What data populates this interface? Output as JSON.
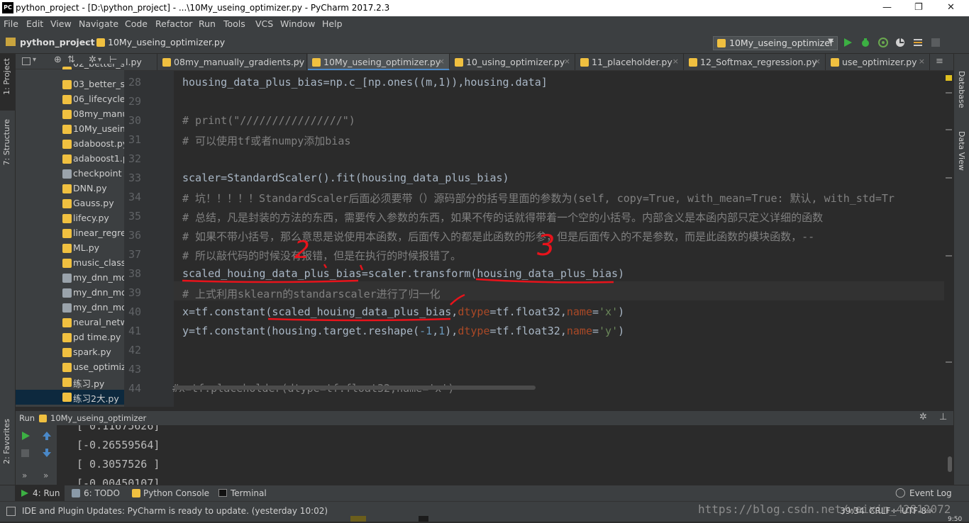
{
  "window": {
    "app_icon": "PC",
    "title": "python_project - [D:\\python_project] - ...\\10My_useing_optimizer.py - PyCharm 2017.2.3",
    "minimize": "—",
    "maximize": "❐",
    "close": "✕"
  },
  "menu": [
    "File",
    "Edit",
    "View",
    "Navigate",
    "Code",
    "Refactor",
    "Run",
    "Tools",
    "VCS",
    "Window",
    "Help"
  ],
  "nav": {
    "project": "python_project",
    "file": "10My_useing_optimizer.py",
    "run_config": "10My_useing_optimizer"
  },
  "left_strip": {
    "project": "1: Project",
    "structure": "7: Structure",
    "favorites": "2: Favorites"
  },
  "right_strip": {
    "database": "Database",
    "dataview": "Data View"
  },
  "project_tree": [
    "02_better_sc",
    "03_better_se",
    "06_lifecycle.p",
    "08my_manua",
    "10My_useing",
    "adaboost.py",
    "adaboost1.p",
    "checkpoint",
    "DNN.py",
    "Gauss.py",
    "lifecy.py",
    "linear_regre",
    "ML.py",
    "music_classi",
    "my_dnn_moc",
    "my_dnn_moc",
    "my_dnn_moc",
    "neural_netw",
    "pd time.py",
    "spark.py",
    "use_optimize",
    "练习.py",
    "练习2大.py"
  ],
  "tabs": [
    "l.py",
    "08my_manually_gradients.py",
    "10My_useing_optimizer.py",
    "10_using_optimizer.py",
    "11_placeholder.py",
    "12_Softmax_regression.py",
    "use_optimizer.py"
  ],
  "tab_close": "×",
  "tab_overflow": "≡",
  "code": {
    "l28a": "housing_data_plus_bias=np.c_[np.ones((m,1)),housing.data]",
    "l30": "# print(\"////////////////\")",
    "l31": "# 可以使用tf或者numpy添加bias",
    "l33": "scaler=StandardScaler().fit(housing_data_plus_bias)",
    "l34": "# 坑！！！！！StandardScaler后面必须要带（）源码部分的括号里面的参数为(self, copy=True, with_mean=True: 默认, with_std=Tr",
    "l35": "# 总结，凡是封装的方法的东西，需要传入参数的东西，如果不传的话就得带着一个空的小括号。内部含义是本函内部只定义详细的函数",
    "l36": "# 如果不带小括号，那么意思是说使用本函数，后面传入的都是此函数的形参，但是后面传入的不是参数，而是此函数的模块函数，--",
    "l37": "# 所以敲代码的时候没有报错，但是在执行的时候报错了。",
    "l38": "scaled_houing_data_plus_bias=scaler.transform(housing_data_plus_bias)",
    "l39": "# 上式利用sklearn的standarscaler进行了归一化",
    "l40a": "x=tf.constant(scaled_houing_data_plus_bias,",
    "l40b": "dtype",
    "l40c": "=tf.float32,",
    "l40d": "name",
    "l40e": "=",
    "l40f": "'x'",
    "l40g": ")",
    "l41a": "y=tf.constant(housing.target.reshape(",
    "l41b": "-1",
    "l41c": ",",
    "l41d": "1",
    "l41e": "),",
    "l41f": "dtype",
    "l41g": "=tf.float32,",
    "l41h": "name",
    "l41i": "=",
    "l41j": "'y'",
    "l41k": ")",
    "l44": "#x=tf.placeholder(dtype=tf.float32,name='x')",
    "line_numbers": [
      "28",
      "29",
      "30",
      "31",
      "32",
      "33",
      "34",
      "35",
      "36",
      "37",
      "38",
      "39",
      "40",
      "41",
      "42",
      "43",
      "44"
    ]
  },
  "annotations": {
    "two": "2",
    "three": "3"
  },
  "run": {
    "label": "Run",
    "config": "10My_useing_optimizer",
    "output": [
      "[ 0.11675626]",
      "[-0.26559564]",
      "[ 0.3057526 ]",
      "[-0.00450107]"
    ]
  },
  "toolwindows": {
    "run": "4: Run",
    "todo": "6: TODO",
    "console": "Python Console",
    "terminal": "Terminal",
    "eventlog": "Event Log"
  },
  "status": {
    "message": "IDE and Plugin Updates: PyCharm is ready to update. (yesterday 10:02)",
    "position": "39:34",
    "crlf": "CRLF÷",
    "encoding": "UTF-8÷",
    "watermark": "https://blog.csdn.net/weixin_42812072",
    "extra": "9:50"
  },
  "colors": {
    "accent": "#4a88c7",
    "annotation": "#e8131b",
    "run_green": "#3cb043"
  }
}
